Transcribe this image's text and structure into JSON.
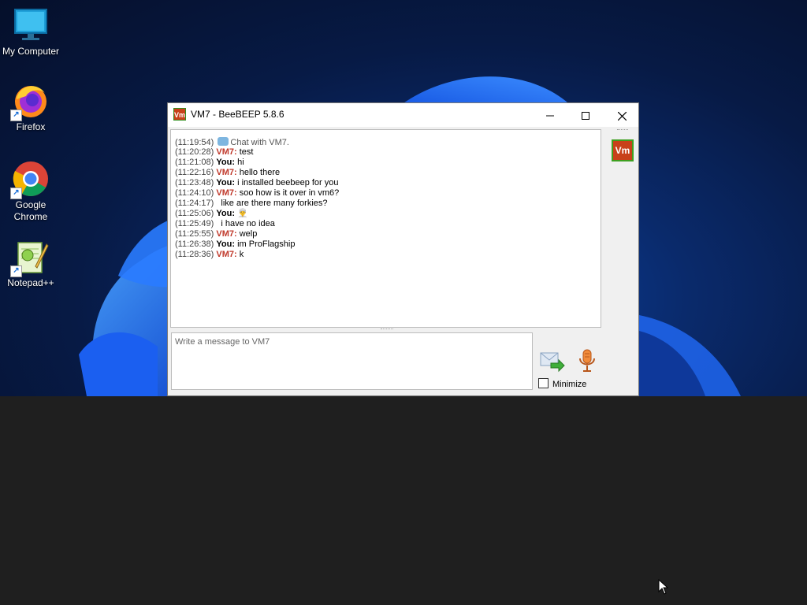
{
  "desktop": {
    "icons": [
      {
        "label": "My Computer",
        "icon": "monitor-icon"
      },
      {
        "label": "Firefox",
        "icon": "firefox-icon"
      },
      {
        "label": "Google Chrome",
        "icon": "chrome-icon"
      },
      {
        "label": "Notepad++",
        "icon": "notepadpp-icon"
      }
    ]
  },
  "window": {
    "title": "VM7 - BeeBEEP 5.8.6",
    "app_icon_text": "Vm",
    "controls": {
      "minimize": "—",
      "maximize": "☐",
      "close": "✕"
    }
  },
  "chat": {
    "messages": [
      {
        "time": "(11:19:54)",
        "sender": "",
        "text": "Chat with VM7.",
        "type": "system"
      },
      {
        "time": "(11:20:28)",
        "sender": "VM7:",
        "text": " test",
        "type": "vm"
      },
      {
        "time": "(11:21:08)",
        "sender": "You:",
        "text": " hi",
        "type": "you"
      },
      {
        "time": "(11:22:16)",
        "sender": "VM7:",
        "text": " hello there",
        "type": "vm"
      },
      {
        "time": "(11:23:48)",
        "sender": "You:",
        "text": " i installed beebeep for you",
        "type": "you"
      },
      {
        "time": "(11:24:10)",
        "sender": "VM7:",
        "text": " soo how is it over in vm6?",
        "type": "vm"
      },
      {
        "time": "(11:24:17)",
        "sender": "",
        "text": "like are there many forkies?",
        "type": "cont"
      },
      {
        "time": "(11:25:06)",
        "sender": "You:",
        "text": " 👳‍♂️",
        "type": "you"
      },
      {
        "time": "(11:25:49)",
        "sender": "",
        "text": "i have no idea",
        "type": "cont"
      },
      {
        "time": "(11:25:55)",
        "sender": "VM7:",
        "text": " welp",
        "type": "vm"
      },
      {
        "time": "(11:26:38)",
        "sender": "You:",
        "text": " im ProFlagship",
        "type": "you"
      },
      {
        "time": "(11:28:36)",
        "sender": "VM7:",
        "text": " k",
        "type": "vm"
      }
    ],
    "input_placeholder": "Write a message to VM7",
    "minimize_label": "Minimize"
  },
  "sidebar": {
    "user_tile_text": "Vm"
  }
}
